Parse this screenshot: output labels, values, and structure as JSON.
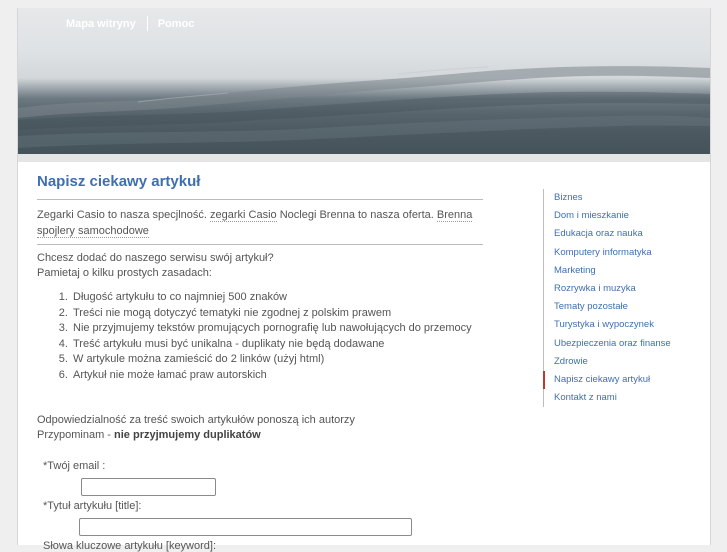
{
  "topnav": {
    "items": [
      "Mapa witryny",
      "Pomoc"
    ]
  },
  "article": {
    "title": "Napisz ciekawy artykuł",
    "intro_1": "Zegarki Casio to nasza specjlność.",
    "link_1": "zegarki Casio",
    "intro_2": "Noclegi Brenna to nasza oferta.",
    "link_2": "Brenna spojlery samochodowe",
    "ask_1": "Chcesz dodać do naszego serwisu swój artykuł?",
    "ask_2": "Pamietaj o kilku prostych zasadach:",
    "rules": [
      "Długość artykułu to co najmniej 500 znaków",
      "Treści nie mogą dotyczyć tematyki nie zgodnej z polskim prawem",
      "Nie przyjmujemy tekstów promujących pornografię lub nawołujących do przemocy",
      "Treść artykułu musi być unikalna - duplikaty nie będą dodawane",
      "W artykule można zamieścić do 2 linków (użyj html)",
      "Artykuł nie może łamać praw autorskich"
    ],
    "resp_1": "Odpowiedzialność za treść swoich artykułów ponoszą ich autorzy",
    "resp_2_prefix": "Przypominam - ",
    "resp_2_bold": "nie przyjmujemy duplikatów"
  },
  "form": {
    "email_label": "*Twój email :",
    "email_value": "",
    "title_label": "*Tytuł artykułu [title]:",
    "title_value": "",
    "keywords_label": "Słowa kluczowe artykułu [keyword]:"
  },
  "sidebar": {
    "items": [
      "Biznes",
      "Dom i mieszkanie",
      "Edukacja oraz nauka",
      "Komputery informatyka",
      "Marketing",
      "Rozrywka i muzyka",
      "Tematy pozostałe",
      "Turystyka i wypoczynek",
      "Ubezpieczenia oraz finanse",
      "Zdrowie",
      "Napisz ciekawy artykuł",
      "Kontakt z nami"
    ],
    "active_item": "Napisz ciekawy artykuł"
  },
  "colors": {
    "link": "#3f6fb0",
    "active_marker": "#c0392b",
    "page_bg": "#efefef"
  }
}
